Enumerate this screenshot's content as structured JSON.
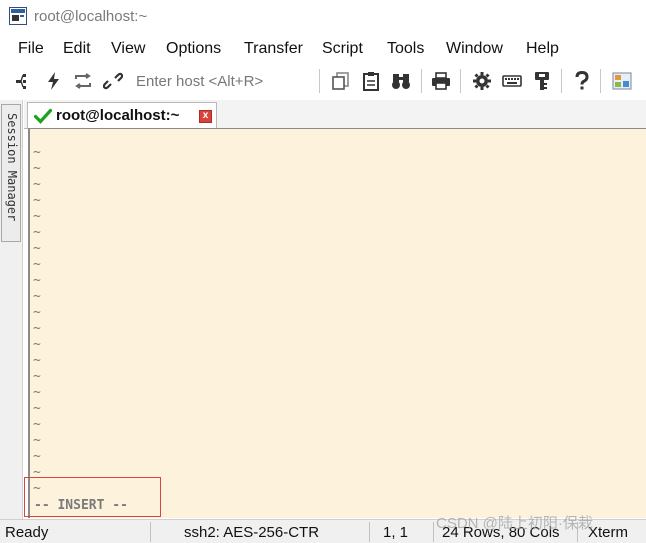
{
  "window": {
    "title": "root@localhost:~"
  },
  "menu": {
    "items": [
      "File",
      "Edit",
      "View",
      "Options",
      "Transfer",
      "Script",
      "Tools",
      "Window",
      "Help"
    ]
  },
  "toolbar": {
    "host_placeholder": "Enter host <Alt+R>",
    "icons": [
      "connect-icon",
      "quick-connect-icon",
      "reconnect-icon",
      "disconnect-icon",
      "copy-icon",
      "paste-icon",
      "find-icon",
      "print-icon",
      "settings-icon",
      "keymap-icon",
      "key-icon",
      "help-icon",
      "sftp-icon"
    ]
  },
  "side_panel": {
    "session_manager_label": "Session Manager"
  },
  "tab": {
    "label": "root@localhost:~",
    "close_label": "x",
    "status_color": "#19a519"
  },
  "terminal": {
    "background": "#fdf3dc",
    "tilde": "~",
    "mode_line": "-- INSERT --"
  },
  "statusbar": {
    "ready": "Ready",
    "cipher": "ssh2: AES-256-CTR",
    "cursor": "1,  1",
    "size": "24 Rows, 80 Cols",
    "term": "Xterm"
  },
  "watermark": "CSDN @陆上初阳·保栽"
}
